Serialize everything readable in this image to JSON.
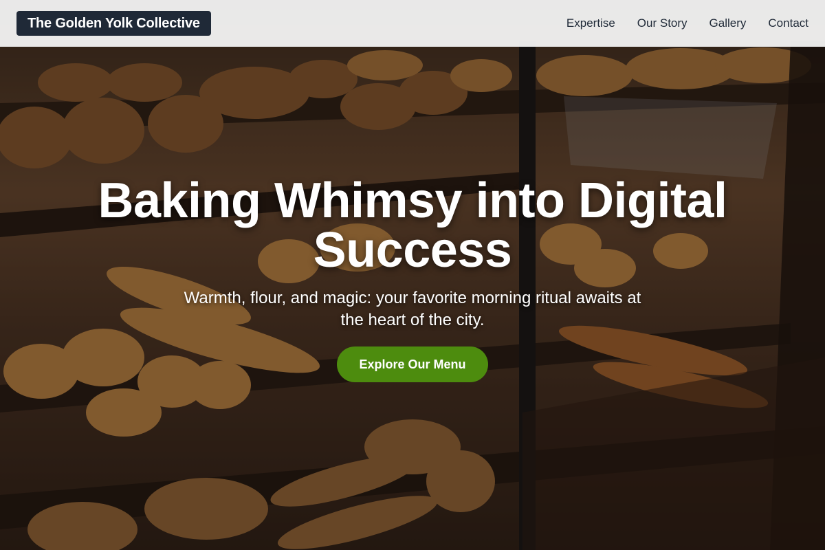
{
  "header": {
    "brand": "The Golden Yolk Collective",
    "nav": [
      {
        "label": "Expertise"
      },
      {
        "label": "Our Story"
      },
      {
        "label": "Gallery"
      },
      {
        "label": "Contact"
      }
    ]
  },
  "hero": {
    "title": "Baking Whimsy into Digital Success",
    "subtitle": "Warmth, flour, and magic: your favorite morning ritual awaits at the heart of the city.",
    "cta_label": "Explore Our Menu",
    "background_image": "bakery-display-case"
  },
  "colors": {
    "brand_bg": "#1f2937",
    "header_bg": "#f5f5f5",
    "cta": "#4d8c0e",
    "text_light": "#ffffff"
  }
}
